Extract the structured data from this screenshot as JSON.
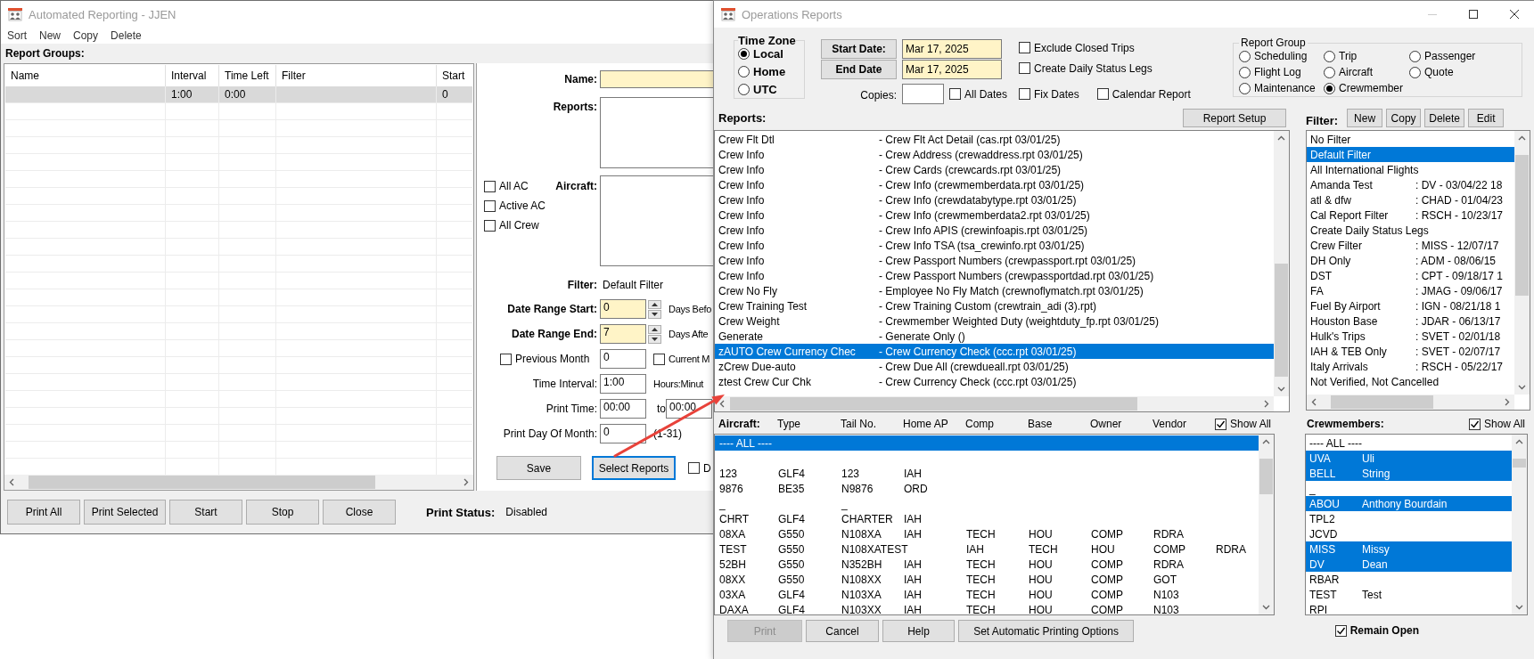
{
  "reporting_window": {
    "title": "Automated Reporting - JJEN",
    "menu": [
      "Sort",
      "New",
      "Copy",
      "Delete"
    ],
    "groups_label": "Report Groups:",
    "table": {
      "columns": [
        "Name",
        "Interval",
        "Time Left",
        "Filter",
        "Start"
      ],
      "rows": [
        {
          "cells": [
            null,
            "1:00",
            "0:00",
            null,
            "0"
          ],
          "selected": true
        }
      ]
    },
    "form": {
      "name_label": "Name:",
      "reports_label": "Reports:",
      "aircraft_label": "Aircraft:",
      "checks": [
        {
          "label": "All AC",
          "checked": false
        },
        {
          "label": "Active AC",
          "checked": false
        },
        {
          "label": "All Crew",
          "checked": false
        }
      ],
      "filter_label": "Filter:",
      "filter_value": "Default Filter",
      "date_range_start": {
        "label": "Date Range Start:",
        "value": "0",
        "suffix": "Days Befo"
      },
      "date_range_end": {
        "label": "Date Range End:",
        "value": "7",
        "suffix": "Days Afte"
      },
      "previous_month": {
        "label": "Previous Month",
        "checked": false,
        "value": "0"
      },
      "current_month": {
        "label": "Current M",
        "checked": false
      },
      "time_interval": {
        "label": "Time Interval:",
        "value": "1:00",
        "unit": "Hours:Minut"
      },
      "print_time": {
        "label": "Print Time:",
        "from": "00:00",
        "to_label": "to",
        "to": "00:00"
      },
      "print_day": {
        "label": "Print Day Of Month:",
        "value": "0",
        "hint": "(1-31)"
      },
      "save": "Save",
      "select_reports": "Select Reports",
      "extra_check": {
        "label": "D",
        "checked": false
      }
    },
    "buttons": [
      "Print All",
      "Print Selected",
      "Start",
      "Stop",
      "Close"
    ],
    "print_status": {
      "label": "Print Status:",
      "value": "Disabled"
    }
  },
  "operations_window": {
    "title": "Operations Reports",
    "time_zone": {
      "title": "Time Zone",
      "options": [
        {
          "label": "Local",
          "selected": true
        },
        {
          "label": "Home",
          "selected": false
        },
        {
          "label": "UTC",
          "selected": false
        }
      ]
    },
    "start_date": {
      "button": "Start Date:",
      "value": "Mar 17, 2025"
    },
    "end_date": {
      "button": "End Date",
      "value": "Mar 17, 2025"
    },
    "options": [
      {
        "label": "Exclude Closed Trips",
        "checked": false
      },
      {
        "label": "Create Daily Status Legs",
        "checked": false
      },
      {
        "label": "All Dates",
        "checked": false
      },
      {
        "label": "Fix Dates",
        "checked": false
      },
      {
        "label": "Calendar Report",
        "checked": false
      }
    ],
    "copies": {
      "label": "Copies:"
    },
    "report_group": {
      "title": "Report Group",
      "options": [
        {
          "label": "Scheduling",
          "selected": false
        },
        {
          "label": "Trip",
          "selected": false
        },
        {
          "label": "Passenger",
          "selected": false
        },
        {
          "label": "Flight Log",
          "selected": false
        },
        {
          "label": "Aircraft",
          "selected": false
        },
        {
          "label": "Quote",
          "selected": false
        },
        {
          "label": "Maintenance",
          "selected": false
        },
        {
          "label": "Crewmember",
          "selected": true
        }
      ]
    },
    "reports": {
      "label": "Reports:",
      "setup_button": "Report Setup",
      "rows": [
        {
          "name": "Crew Flt Dtl",
          "description": "- Crew Flt Act Detail (cas.rpt 03/01/25)",
          "selected": false
        },
        {
          "name": "Crew Info",
          "description": "- Crew Address (crewaddress.rpt 03/01/25)",
          "selected": false
        },
        {
          "name": "Crew Info",
          "description": "- Crew Cards (crewcards.rpt 03/01/25)",
          "selected": false
        },
        {
          "name": "Crew Info",
          "description": "- Crew Info (crewmemberdata.rpt 03/01/25)",
          "selected": false
        },
        {
          "name": "Crew Info",
          "description": "- Crew Info (crewdatabytype.rpt 03/01/25)",
          "selected": false
        },
        {
          "name": "Crew Info",
          "description": "- Crew Info (crewmemberdata2.rpt 03/01/25)",
          "selected": false
        },
        {
          "name": "Crew Info",
          "description": "- Crew Info APIS (crewinfoapis.rpt 03/01/25)",
          "selected": false
        },
        {
          "name": "Crew Info",
          "description": "- Crew Info TSA (tsa_crewinfo.rpt 03/01/25)",
          "selected": false
        },
        {
          "name": "Crew Info",
          "description": "- Crew Passport Numbers (crewpassport.rpt 03/01/25)",
          "selected": false
        },
        {
          "name": "Crew Info",
          "description": "- Crew Passport Numbers (crewpassportdad.rpt 03/01/25)",
          "selected": false
        },
        {
          "name": "Crew No Fly",
          "description": "- Employee No Fly Match (crewnoflymatch.rpt 03/01/25)",
          "selected": false
        },
        {
          "name": "Crew Training Test",
          "description": "- Crew Training Custom (crewtrain_adi (3).rpt)",
          "selected": false
        },
        {
          "name": "Crew Weight",
          "description": "- Crewmember Weighted Duty (weightduty_fp.rpt 03/01/25)",
          "selected": false
        },
        {
          "name": "Generate",
          "description": "- Generate Only ()",
          "selected": false
        },
        {
          "name": "zAUTO Crew Currency Chec",
          "description": "- Crew Currency Check (ccc.rpt 03/01/25)",
          "selected": true
        },
        {
          "name": "zCrew Due-auto",
          "description": "- Crew Due All (crewdueall.rpt 03/01/25)",
          "selected": false
        },
        {
          "name": "ztest Crew Cur Chk",
          "description": "- Crew Currency Check (ccc.rpt 03/01/25)",
          "selected": false
        }
      ]
    },
    "filter": {
      "label": "Filter:",
      "buttons": [
        "New",
        "Copy",
        "Delete",
        "Edit"
      ],
      "rows": [
        {
          "name": "No Filter",
          "selected": false
        },
        {
          "name": "Default Filter",
          "selected": true
        },
        {
          "name": "All International Flights",
          "selected": false
        },
        {
          "name": "Amanda Test",
          "detail": ": DV - 03/04/22 18",
          "selected": false
        },
        {
          "name": "atl & dfw",
          "detail": ": CHAD - 01/04/23",
          "selected": false
        },
        {
          "name": "Cal Report Filter",
          "detail": ": RSCH - 10/23/17",
          "selected": false
        },
        {
          "name": "Create Daily Status Legs",
          "selected": false
        },
        {
          "name": "Crew Filter",
          "detail": ": MISS - 12/07/17",
          "selected": false
        },
        {
          "name": "DH Only",
          "detail": ": ADM - 08/06/15",
          "selected": false
        },
        {
          "name": "DST",
          "detail": ": CPT - 09/18/17 1",
          "selected": false
        },
        {
          "name": "FA",
          "detail": ": JMAG - 09/06/17",
          "selected": false
        },
        {
          "name": "Fuel By Airport",
          "detail": ": IGN - 08/21/18 1",
          "selected": false
        },
        {
          "name": "Houston Base",
          "detail": ": JDAR - 06/13/17",
          "selected": false
        },
        {
          "name": "Hulk's Trips",
          "detail": ": SVET - 02/01/18",
          "selected": false
        },
        {
          "name": "IAH & TEB Only",
          "detail": ": SVET - 02/07/17",
          "selected": false
        },
        {
          "name": "Italy Arrivals",
          "detail": ": RSCH - 05/22/17",
          "selected": false
        },
        {
          "name": "Not Verified, Not Cancelled",
          "selected": false
        }
      ]
    },
    "aircraft": {
      "columns": [
        "Aircraft:",
        "Type",
        "Tail No.",
        "Home AP",
        "Comp",
        "Base",
        "Owner",
        "Vendor"
      ],
      "show_all": {
        "label": "Show All",
        "checked": true
      },
      "rows": [
        {
          "cells": [
            "---- ALL ----"
          ],
          "selected": true
        },
        {
          "cells": [
            null
          ]
        },
        {
          "cells": [
            "123",
            "GLF4",
            "123",
            "IAH"
          ],
          "selected": false
        },
        {
          "cells": [
            "9876",
            "BE35",
            "N9876",
            "ORD"
          ],
          "selected": false
        },
        {
          "cells": [
            "_",
            null,
            "_"
          ],
          "selected": false
        },
        {
          "cells": [
            "CHRT",
            "GLF4",
            "CHARTER",
            "IAH"
          ],
          "selected": false
        },
        {
          "cells": [
            "08XA",
            "G550",
            "N108XA",
            "IAH",
            "TECH",
            "HOU",
            "COMP",
            "RDRA"
          ],
          "selected": false
        },
        {
          "cells": [
            "TEST",
            "G550",
            "N108XATEST",
            null,
            "IAH",
            "TECH",
            "HOU",
            "COMP",
            "RDRA"
          ],
          "selected": false
        },
        {
          "cells": [
            "52BH",
            "G550",
            "N352BH",
            "IAH",
            "TECH",
            "HOU",
            "COMP",
            "RDRA"
          ],
          "selected": false
        },
        {
          "cells": [
            "08XX",
            "G550",
            "N108XX",
            "IAH",
            "TECH",
            "HOU",
            "COMP",
            "GOT"
          ],
          "selected": false
        },
        {
          "cells": [
            "03XA",
            "GLF4",
            "N103XA",
            "IAH",
            "TECH",
            "HOU",
            "COMP",
            "N103"
          ],
          "selected": false
        },
        {
          "cells": [
            "DAXA",
            "GLF4",
            "N103XX",
            "IAH",
            "TECH",
            "HOU",
            "COMP",
            "N103"
          ],
          "selected": false
        }
      ]
    },
    "crewmembers": {
      "label": "Crewmembers:",
      "show_all": {
        "label": "Show All",
        "checked": true
      },
      "rows": [
        {
          "code": "---- ALL ----",
          "selected": false
        },
        {
          "code": "UVA",
          "name": "Uli",
          "selected": true
        },
        {
          "code": "BELL",
          "name": "String",
          "selected": true
        },
        {
          "code": "_",
          "selected": false
        },
        {
          "code": "ABOU",
          "name": "Anthony Bourdain",
          "selected": true
        },
        {
          "code": "TPL2",
          "selected": false
        },
        {
          "code": "JCVD",
          "selected": false
        },
        {
          "code": "MISS",
          "name": "Missy",
          "selected": true
        },
        {
          "code": "DV",
          "name": "Dean",
          "selected": true
        },
        {
          "code": "RBAR",
          "selected": false
        },
        {
          "code": "TEST",
          "name": "Test",
          "selected": false
        },
        {
          "code": "RPI",
          "selected": false
        }
      ]
    },
    "buttons": [
      {
        "label": "Print",
        "disabled": true
      },
      {
        "label": "Cancel",
        "disabled": false
      },
      {
        "label": "Help",
        "disabled": false
      },
      {
        "label": "Set Automatic Printing Options",
        "disabled": false
      }
    ],
    "remain_open": {
      "label": "Remain Open",
      "checked": true
    }
  }
}
